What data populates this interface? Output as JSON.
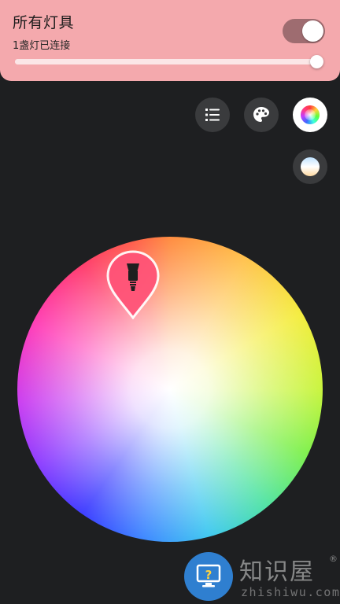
{
  "header": {
    "title": "所有灯具",
    "subtitle": "1盏灯已连接",
    "power_on": true,
    "brightness": 0.99,
    "background_color": "#f4a9ad"
  },
  "toolbar": {
    "buttons": [
      {
        "name": "list",
        "icon": "list-icon",
        "active": false
      },
      {
        "name": "scenes",
        "icon": "palette-icon",
        "active": false
      },
      {
        "name": "color",
        "icon": "color-wheel-icon",
        "active": true
      }
    ],
    "secondary": {
      "name": "white-temperature",
      "icon": "white-temperature-icon",
      "active": false
    }
  },
  "color_picker": {
    "marker_icon": "bulb-icon",
    "selected_color": "#ff4f6e"
  },
  "watermark": {
    "brand_cn": "知识屋",
    "registered": "®",
    "brand_en": "zhishiwu.com",
    "badge_icon": "monitor-help-icon"
  }
}
